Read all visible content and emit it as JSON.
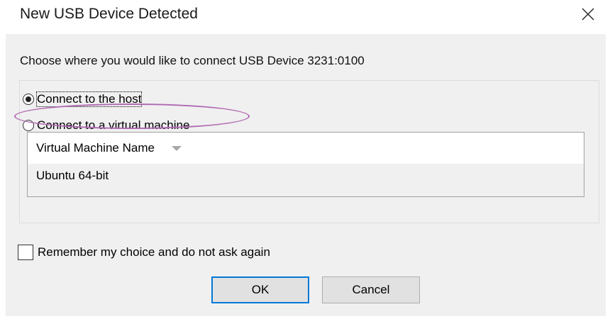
{
  "window": {
    "title": "New USB Device Detected",
    "close_icon": "close-icon"
  },
  "dialog": {
    "prompt": "Choose where you would like to connect USB Device 3231:0100",
    "options": [
      {
        "label": "Connect to the host",
        "selected": true
      },
      {
        "label": "Connect to a virtual machine",
        "selected": false
      }
    ],
    "vm_table": {
      "column_header": "Virtual Machine Name",
      "sort_icon": "sort-down-icon",
      "rows": [
        "Ubuntu 64-bit"
      ]
    },
    "remember_label": "Remember my choice and do not ask again",
    "remember_checked": false,
    "buttons": {
      "ok_label": "OK",
      "cancel_label": "Cancel"
    }
  },
  "colors": {
    "highlight_ellipse": "#b06ab3",
    "default_button_border": "#0078d7",
    "dialog_background": "#f0f0f0"
  }
}
